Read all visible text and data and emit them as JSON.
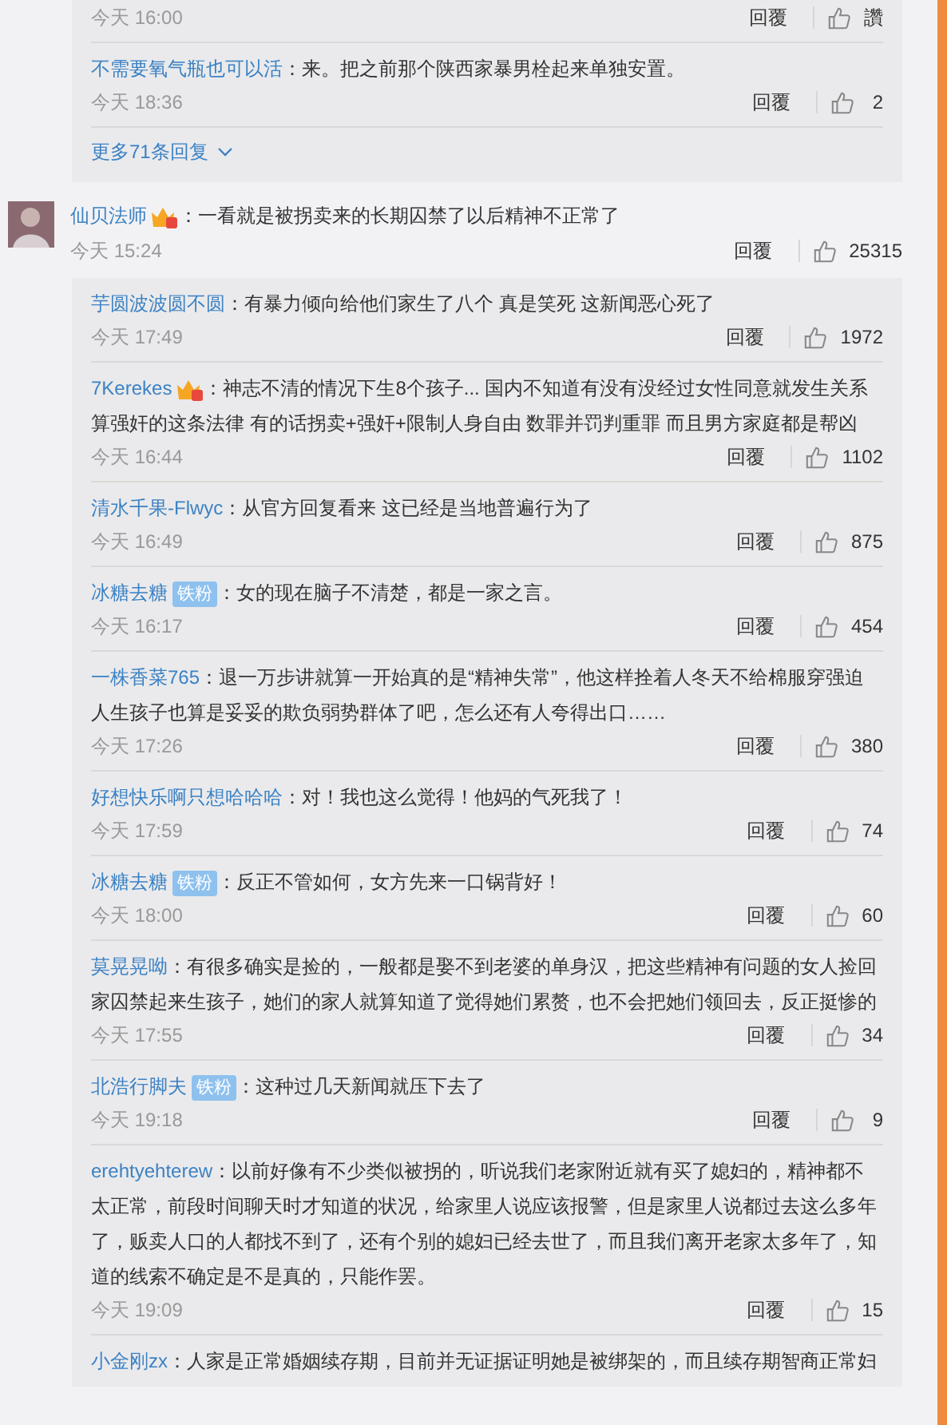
{
  "top_thread": {
    "replies": [
      {
        "time": "今天 16:00",
        "reply_label": "回覆",
        "likes": "讚"
      },
      {
        "name": "不需要氧气瓶也可以活",
        "text": "：来。把之前那个陕西家暴男栓起来单独安置。",
        "time": "今天 18:36",
        "reply_label": "回覆",
        "likes": "2"
      }
    ],
    "more": "更多71条回复"
  },
  "comment": {
    "name": "仙贝法师",
    "badge": {
      "kind": "crown"
    },
    "text": "：一看就是被拐卖来的长期囚禁了以后精神不正常了",
    "time": "今天 15:24",
    "reply_label": "回覆",
    "likes": "25315"
  },
  "replies": [
    {
      "name": "芋圆波波圆不圆",
      "text": "：有暴力倾向给他们家生了八个 真是笑死 这新闻恶心死了",
      "time": "今天 17:49",
      "reply_label": "回覆",
      "likes": "1972"
    },
    {
      "name": "7Kerekes",
      "badge": {
        "kind": "crown"
      },
      "text": "：神志不清的情况下生8个孩子... 国内不知道有没有没经过女性同意就发生关系算强奸的这条法律 有的话拐卖+强奸+限制人身自由 数罪并罚判重罪 而且男方家庭都是帮凶",
      "time": "今天 16:44",
      "reply_label": "回覆",
      "likes": "1102"
    },
    {
      "name": "清水千果-Flwyc",
      "text": "：从官方回复看来 这已经是当地普遍行为了",
      "time": "今天 16:49",
      "reply_label": "回覆",
      "likes": "875"
    },
    {
      "name": "冰糖去糖",
      "badge": {
        "kind": "fan",
        "label": "铁粉"
      },
      "text": "：女的现在脑子不清楚，都是一家之言。",
      "time": "今天 16:17",
      "reply_label": "回覆",
      "likes": "454"
    },
    {
      "name": "一株香菜765",
      "text": "：退一万步讲就算一开始真的是“精神失常”，他这样拴着人冬天不给棉服穿强迫人生孩子也算是妥妥的欺负弱势群体了吧，怎么还有人夸得出口……",
      "time": "今天 17:26",
      "reply_label": "回覆",
      "likes": "380"
    },
    {
      "name": "好想快乐啊只想哈哈哈",
      "text": "：对！我也这么觉得！他妈的气死我了！",
      "time": "今天 17:59",
      "reply_label": "回覆",
      "likes": "74"
    },
    {
      "name": "冰糖去糖",
      "badge": {
        "kind": "fan",
        "label": "铁粉"
      },
      "text": "：反正不管如何，女方先来一口锅背好！",
      "time": "今天 18:00",
      "reply_label": "回覆",
      "likes": "60"
    },
    {
      "name": "莫晃晃呦",
      "text": "：有很多确实是捡的，一般都是娶不到老婆的单身汉，把这些精神有问题的女人捡回家囚禁起来生孩子，她们的家人就算知道了觉得她们累赘，也不会把她们领回去，反正挺惨的",
      "time": "今天 17:55",
      "reply_label": "回覆",
      "likes": "34"
    },
    {
      "name": "北浩行脚夫",
      "badge": {
        "kind": "fan",
        "label": "铁粉"
      },
      "text": "：这种过几天新闻就压下去了",
      "time": "今天 19:18",
      "reply_label": "回覆",
      "likes": "9"
    },
    {
      "name": "erehtyehterew",
      "text": "：以前好像有不少类似被拐的，听说我们老家附近就有买了媳妇的，精神都不太正常，前段时间聊天时才知道的状况，给家里人说应该报警，但是家里人说都过去这么多年了，贩卖人口的人都找不到了，还有个别的媳妇已经去世了，而且我们离开老家太多年了，知道的线索不确定是不是真的，只能作罢。",
      "time": "今天 19:09",
      "reply_label": "回覆",
      "likes": "15"
    },
    {
      "name": "小金刚zx",
      "text": "：人家是正常婚姻续存期，目前并无证据证明她是被绑架的，而且续存期智商正常妇"
    }
  ]
}
